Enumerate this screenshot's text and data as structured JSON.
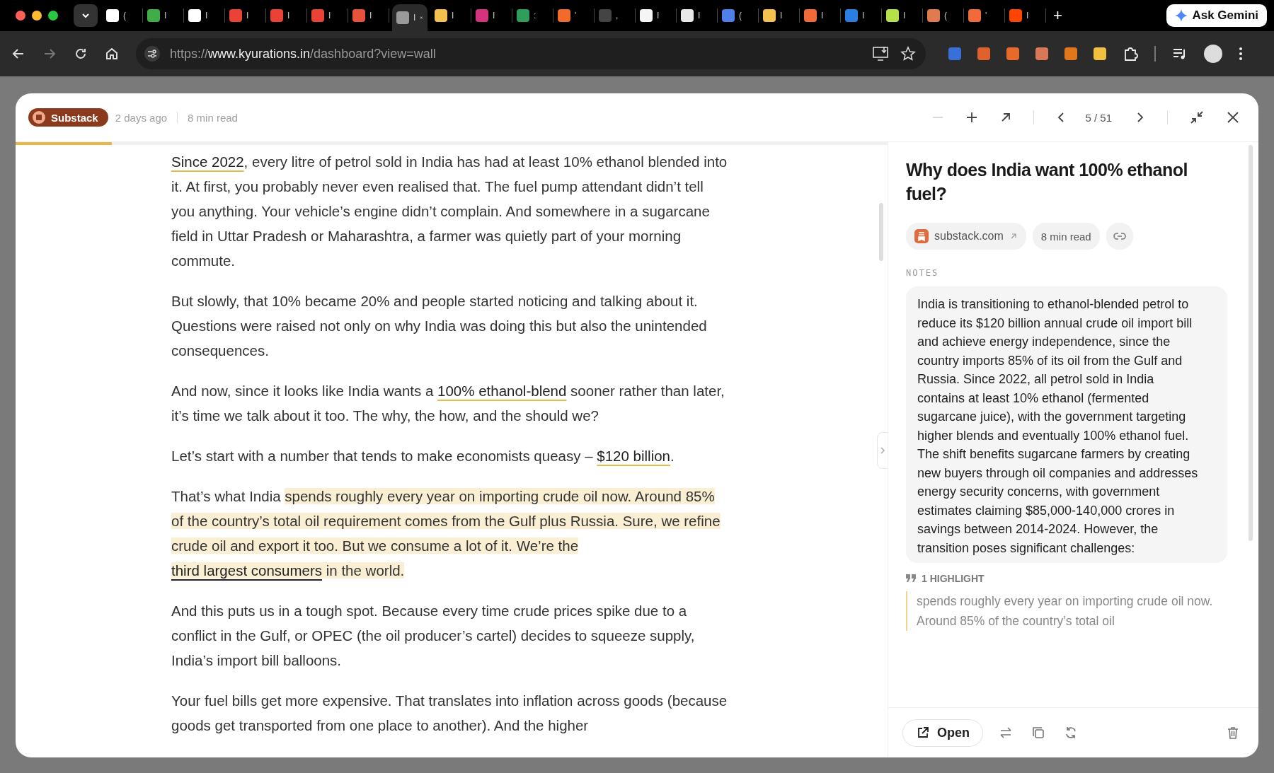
{
  "browser": {
    "tabs": [
      {
        "title": "(",
        "color": "#ffffff",
        "selected": false
      },
      {
        "title": "I",
        "color": "#3fae49",
        "selected": false
      },
      {
        "title": "I",
        "color": "#ffffff",
        "selected": false
      },
      {
        "title": "I",
        "color": "#ea4335",
        "selected": false
      },
      {
        "title": "I",
        "color": "#ea4335",
        "selected": false
      },
      {
        "title": "I",
        "color": "#ea4335",
        "selected": false
      },
      {
        "title": "I",
        "color": "#e8523a",
        "selected": false
      },
      {
        "title": "I",
        "color": "#9a9a9a",
        "selected": true
      },
      {
        "title": "I",
        "color": "#f2c14e",
        "selected": false
      },
      {
        "title": "I",
        "color": "#d6337f",
        "selected": false
      },
      {
        "title": ":",
        "color": "#2f9e5b",
        "selected": false
      },
      {
        "title": "'",
        "color": "#f26b2a",
        "selected": false
      },
      {
        "title": ",",
        "color": "#444444",
        "selected": false
      },
      {
        "title": "I",
        "color": "#f5f5f5",
        "selected": false
      },
      {
        "title": "I",
        "color": "#e8e8e8",
        "selected": false
      },
      {
        "title": "(",
        "color": "#4f7fe8",
        "selected": false
      },
      {
        "title": "I",
        "color": "#f2c14e",
        "selected": false
      },
      {
        "title": "I",
        "color": "#f06a3a",
        "selected": false
      },
      {
        "title": "I",
        "color": "#2a7de1",
        "selected": false
      },
      {
        "title": "I",
        "color": "#b4e04a",
        "selected": false
      },
      {
        "title": "(",
        "color": "#e07a4f",
        "selected": false
      },
      {
        "title": "'",
        "color": "#f06a3a",
        "selected": false
      },
      {
        "title": "I",
        "color": "#ff4500",
        "selected": false
      }
    ],
    "new_tab": "+",
    "gemini_button": "Ask Gemini",
    "url": {
      "scheme": "https://",
      "host": "www.kyurations.in",
      "path": "/dashboard?view=wall"
    },
    "extensions": [
      {
        "color": "#3b6fd8"
      },
      {
        "color": "#e0612c"
      },
      {
        "color": "#e86a2a"
      },
      {
        "color": "#d97757"
      },
      {
        "color": "#e2761b"
      },
      {
        "color": "#f0c040"
      }
    ]
  },
  "reader": {
    "source_badge": "Substack",
    "age": "2 days ago",
    "read_time": "8 min read",
    "position": "5 / 51",
    "zoom_out_disabled": true,
    "progress": {
      "level": 0.11
    },
    "paragraphs": [
      {
        "segments": [
          {
            "kind": "link",
            "text": "Since 2022"
          },
          {
            "kind": "plain",
            "text": ", every litre of petrol sold in India has had at least 10% ethanol blended into it. At first, you probably never even realised that. The fuel pump attendant didn’t tell you anything. Your vehicle’s engine didn’t complain. And somewhere in a sugarcane field in Uttar Pradesh or Maharashtra, a farmer was quietly part of your morning commute."
          }
        ]
      },
      {
        "segments": [
          {
            "kind": "plain",
            "text": "But slowly, that 10% became 20% and people started noticing and talking about it. Questions were raised not only on why India was doing this but also the unintended consequences."
          }
        ]
      },
      {
        "segments": [
          {
            "kind": "plain",
            "text": "And now, since it looks like India wants a "
          },
          {
            "kind": "link",
            "text": "100% ethanol-blend"
          },
          {
            "kind": "plain",
            "text": " sooner rather than later, it’s time we talk about it too. The why, the how, and the should we?"
          }
        ]
      },
      {
        "segments": [
          {
            "kind": "plain",
            "text": "Let’s start with a number that tends to make economists queasy – "
          },
          {
            "kind": "link",
            "text": "$120 billion"
          },
          {
            "kind": "plain",
            "text": "."
          }
        ]
      },
      {
        "segments": [
          {
            "kind": "plain",
            "text": "That’s what India "
          },
          {
            "kind": "highlight",
            "text": "spends roughly every year on importing crude oil now. Around 85% of the country’s total oil requirement comes from the Gulf plus Russia. Sure, we refine crude oil and export it too. But we consume a lot of it. We’re the "
          },
          {
            "kind": "highlight-link",
            "text": "third largest consumers"
          },
          {
            "kind": "highlight",
            "text": " in the world."
          }
        ]
      },
      {
        "segments": [
          {
            "kind": "plain",
            "text": "And this puts us in a tough spot. Because every time crude prices spike due to a conflict in the Gulf, or OPEC (the oil producer’s cartel) decides to squeeze supply, India’s import bill balloons."
          }
        ]
      },
      {
        "segments": [
          {
            "kind": "plain",
            "text": "Your fuel bills get more expensive. That translates into inflation across goods (because goods get transported from one place to another). And the higher"
          }
        ]
      }
    ],
    "panel": {
      "title": "Why does India want 100% ethanol fuel?",
      "source": "substack.com",
      "read_time": "8 min read",
      "notes_label": "NOTES",
      "notes": "India is transitioning to ethanol-blended petrol to reduce its $120 billion annual crude oil import bill and achieve energy independence, since the country imports 85% of its oil from the Gulf and Russia. Since 2022, all petrol sold in India contains at least 10% ethanol (fermented sugarcane juice), with the government targeting higher blends and eventually 100% ethanol fuel. The shift benefits sugarcane farmers by creating new buyers through oil companies and addresses energy security concerns, with government estimates claiming $85,000-140,000 crores in savings between 2014-2024. However, the transition poses significant challenges:",
      "highlights_label": "1 HIGHLIGHT",
      "highlights": [
        "spends roughly every year on importing crude oil now. Around 85% of the country’s total oil"
      ],
      "open_button": "Open"
    }
  }
}
